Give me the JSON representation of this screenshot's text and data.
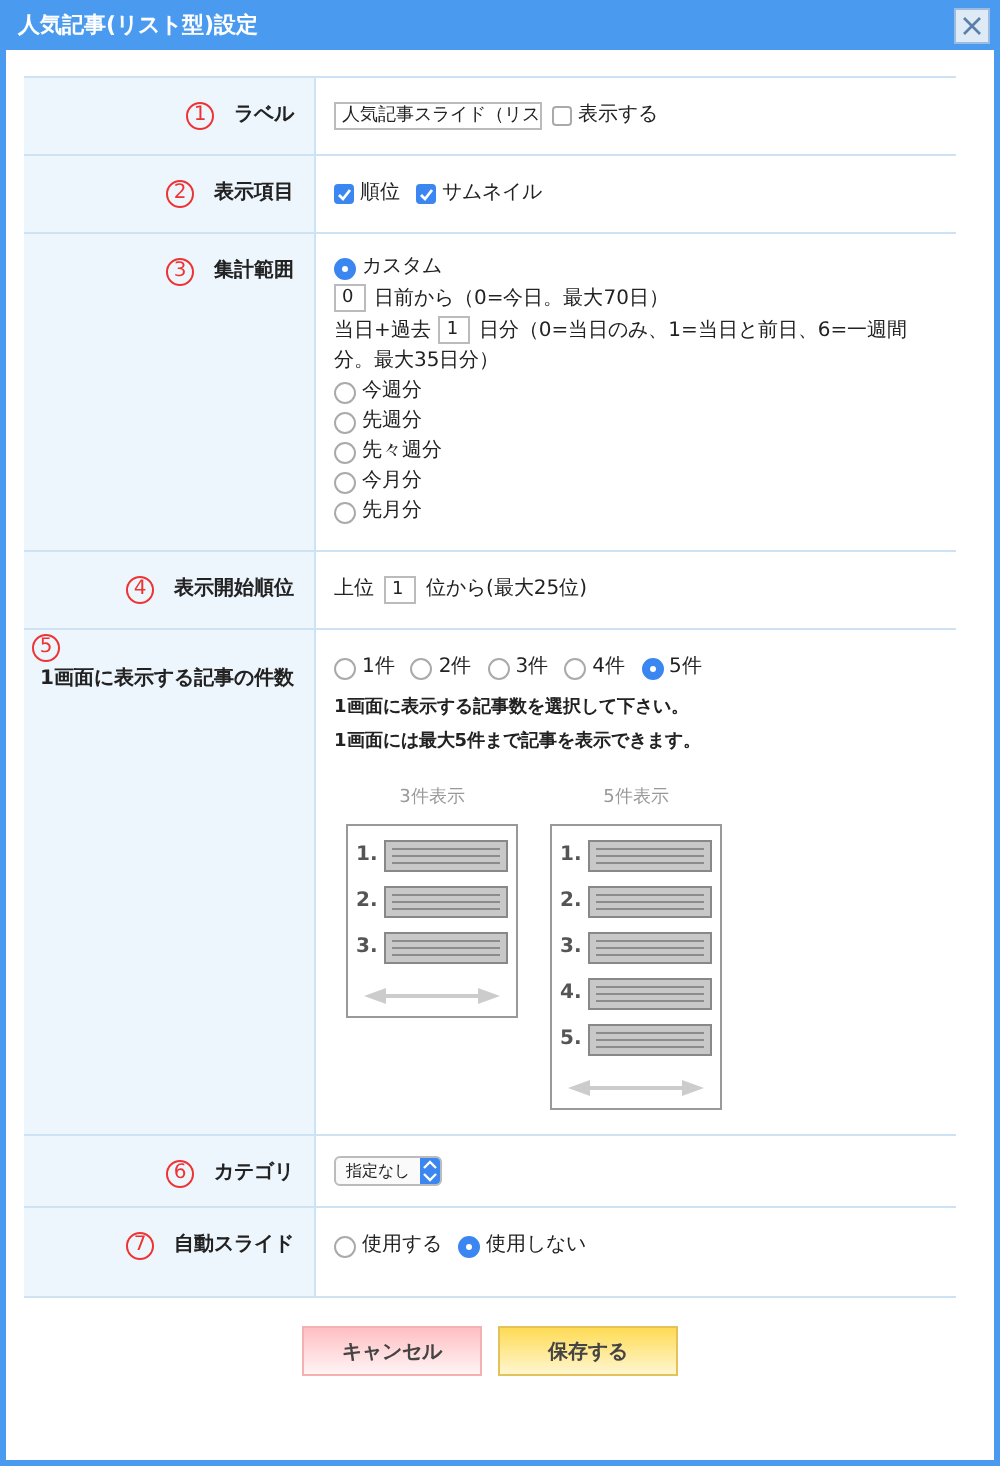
{
  "window": {
    "title": "人気記事(リスト型)設定"
  },
  "rows": [
    {
      "marker": "1",
      "label": "ラベル",
      "kind": "text_check",
      "value": "人気記事スライド（リス",
      "check": {
        "label": "表示する",
        "checked": false
      }
    },
    {
      "marker": "2",
      "label": "表示項目",
      "kind": "checks",
      "checks": [
        {
          "label": "順位",
          "checked": true
        },
        {
          "label": "サムネイル",
          "checked": true
        }
      ]
    },
    {
      "marker": "3",
      "label": "集計範囲",
      "kind": "range",
      "options": [
        {
          "label": "カスタム",
          "selected": true,
          "lines": [
            {
              "value": "0",
              "after": "日前から（0=今日。最大70日）"
            },
            {
              "before": "当日+過去",
              "value": "1",
              "after": "日分（0=当日のみ、1=当日と前日、6=一週間分。最大35日分）"
            }
          ]
        },
        {
          "label": "今週分",
          "selected": false
        },
        {
          "label": "先週分",
          "selected": false
        },
        {
          "label": "先々週分",
          "selected": false
        },
        {
          "label": "今月分",
          "selected": false
        },
        {
          "label": "先月分",
          "selected": false
        }
      ]
    },
    {
      "marker": "4",
      "label": "表示開始順位",
      "kind": "number",
      "before": "上位",
      "value": "1",
      "after": "位から(最大25位)"
    },
    {
      "marker": "5",
      "label": "1画面に表示する記事の件数",
      "kind": "count",
      "options": [
        {
          "label": "1件",
          "selected": false
        },
        {
          "label": "2件",
          "selected": false
        },
        {
          "label": "3件",
          "selected": false
        },
        {
          "label": "4件",
          "selected": false
        },
        {
          "label": "5件",
          "selected": true
        }
      ],
      "notes": [
        "1画面に表示する記事数を選択して下さい。",
        "1画面には最大5件まで記事を表示できます。"
      ],
      "previews": [
        {
          "caption": "3件表示",
          "items": [
            "1.",
            "2.",
            "3."
          ]
        },
        {
          "caption": "5件表示",
          "items": [
            "1.",
            "2.",
            "3.",
            "4.",
            "5."
          ]
        }
      ]
    },
    {
      "marker": "6",
      "label": "カテゴリ",
      "kind": "select",
      "value": "指定なし"
    },
    {
      "marker": "7",
      "label": "自動スライド",
      "kind": "radios",
      "options": [
        {
          "label": "使用する",
          "selected": false
        },
        {
          "label": "使用しない",
          "selected": true
        }
      ]
    }
  ],
  "buttons": [
    {
      "label": "キャンセル",
      "kind": "cancel"
    },
    {
      "label": "保存する",
      "kind": "save"
    }
  ]
}
